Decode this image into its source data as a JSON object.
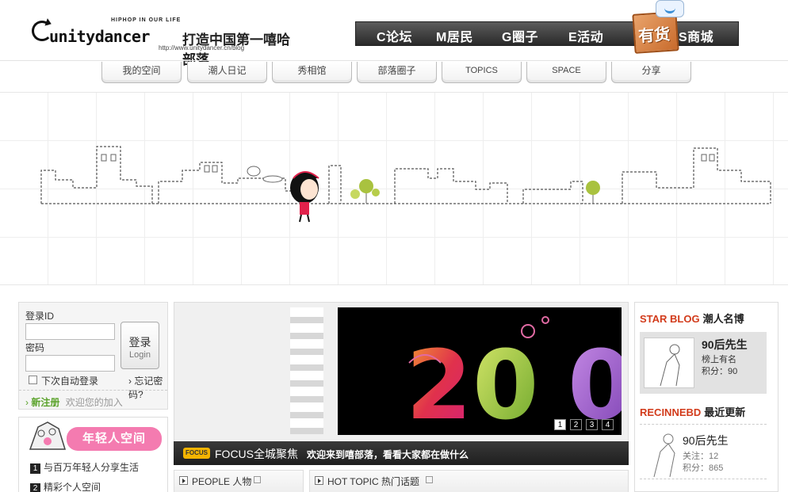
{
  "header": {
    "slogan_top": "HIPHOP IN OUR LIFE",
    "brand": "unitydancer",
    "brand_cn": "打造中国第一嘻哈部落",
    "url": "http://www.unitydancer.cn/blog"
  },
  "main_nav": [
    {
      "label": "C论坛"
    },
    {
      "label": "M居民"
    },
    {
      "label": "G圈子"
    },
    {
      "label": "E活动"
    },
    {
      "label": "S商城"
    }
  ],
  "shop_badge": "有货",
  "sub_nav": [
    {
      "label": "我的空间"
    },
    {
      "label": "潮人日记"
    },
    {
      "label": "秀相馆"
    },
    {
      "label": "部落圈子"
    },
    {
      "label": "TOPICS"
    },
    {
      "label": "SPACE"
    },
    {
      "label": "分享"
    }
  ],
  "login": {
    "id_label": "登录ID",
    "pwd_label": "密码",
    "id_value": "",
    "pwd_value": "",
    "btn_cn": "登录",
    "btn_en": "Login",
    "auto_login": "下次自动登录",
    "forget": "忘记密码?",
    "register": "新注册",
    "welcome": "欢迎您的加入"
  },
  "youth": {
    "title": "年轻人空间",
    "items": [
      {
        "num": "1",
        "text": "与百万年轻人分享生活"
      },
      {
        "num": "2",
        "text": "精彩个人空间"
      }
    ]
  },
  "focus": {
    "slide_text": "200",
    "pages": [
      "1",
      "2",
      "3",
      "4"
    ],
    "active_page": "1",
    "tag": "FOCUS",
    "title": "FOCUS全城聚焦",
    "subtitle": "欢迎来到嘻部落，看看大家都在做什么"
  },
  "panels": {
    "people": "PEOPLE 人物",
    "hot_topic": "HOT TOPIC 热门话题"
  },
  "right": {
    "star_red": "STAR BLOG",
    "star_black": "潮人名博",
    "star_user": {
      "name": "90后先生",
      "line1": "榜上有名",
      "line2": "积分：90"
    },
    "recent_red": "RECINNEBD",
    "recent_black": "最近更新",
    "recent_user": {
      "name": "90后先生",
      "line1": "关注：12",
      "line2": "积分：865"
    }
  },
  "colors": {
    "accent_red": "#d23b1b",
    "nav_dark": "#2a2a2a",
    "register_green": "#5aa22a",
    "youth_pink": "#f47bb0",
    "focus_tag": "#f4b400"
  }
}
